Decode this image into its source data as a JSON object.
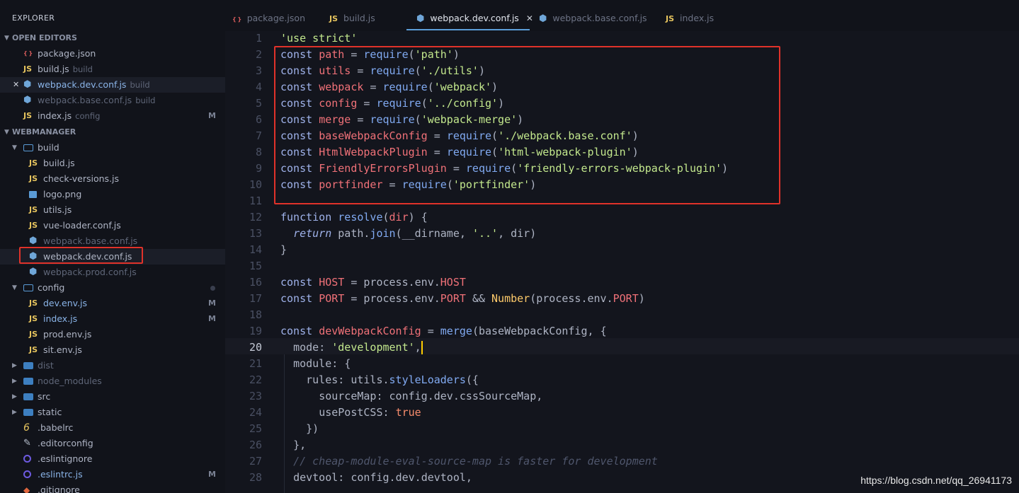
{
  "sidebar": {
    "title": "EXPLORER",
    "open_editors_header": "OPEN EDITORS",
    "open_editors": [
      {
        "icon": "json",
        "name": "package.json",
        "detail": "",
        "status": "",
        "prefix": ""
      },
      {
        "icon": "JS",
        "name": "build.js",
        "detail": "build",
        "status": "",
        "prefix": ""
      },
      {
        "icon": "hex",
        "name": "webpack.dev.conf.js",
        "detail": "build",
        "status": "",
        "prefix": "✕"
      },
      {
        "icon": "hex",
        "name": "webpack.base.conf.js",
        "detail": "build",
        "status": "",
        "prefix": ""
      },
      {
        "icon": "JS",
        "name": "index.js",
        "detail": "config",
        "status": "M",
        "prefix": ""
      }
    ],
    "project_header": "WEBMANAGER",
    "build_folder": "build",
    "build_files": [
      {
        "icon": "JS",
        "name": "build.js"
      },
      {
        "icon": "JS",
        "name": "check-versions.js"
      },
      {
        "icon": "img",
        "name": "logo.png"
      },
      {
        "icon": "JS",
        "name": "utils.js"
      },
      {
        "icon": "JS",
        "name": "vue-loader.conf.js"
      },
      {
        "icon": "hex",
        "name": "webpack.base.conf.js"
      },
      {
        "icon": "hex",
        "name": "webpack.dev.conf.js"
      },
      {
        "icon": "hex",
        "name": "webpack.prod.conf.js"
      }
    ],
    "config_folder": "config",
    "config_files": [
      {
        "icon": "JS",
        "name": "dev.env.js",
        "status": "M"
      },
      {
        "icon": "JS",
        "name": "index.js",
        "status": "M"
      },
      {
        "icon": "JS",
        "name": "prod.env.js",
        "status": ""
      },
      {
        "icon": "JS",
        "name": "sit.env.js",
        "status": ""
      }
    ],
    "collapsed_folders": [
      "dist",
      "node_modules",
      "src",
      "static"
    ],
    "root_files": [
      {
        "icon": "babel",
        "name": ".babelrc",
        "status": ""
      },
      {
        "icon": "gear",
        "name": ".editorconfig",
        "status": ""
      },
      {
        "icon": "ring",
        "name": ".eslintignore",
        "status": ""
      },
      {
        "icon": "ring",
        "name": ".eslintrc.js",
        "status": "M"
      },
      {
        "icon": "git",
        "name": ".gitignore",
        "status": ""
      }
    ]
  },
  "tabs": [
    {
      "icon": "json",
      "label": "package.json",
      "active": false
    },
    {
      "icon": "JS",
      "label": "build.js",
      "active": false
    },
    {
      "icon": "hex",
      "label": "webpack.dev.conf.js",
      "active": true
    },
    {
      "icon": "hex",
      "label": "webpack.base.conf.js",
      "active": false
    },
    {
      "icon": "JS",
      "label": "index.js",
      "active": false
    }
  ],
  "tab_close": "✕",
  "editor": {
    "current_line": 20,
    "lines": [
      [
        [
          "str",
          "'use strict'"
        ]
      ],
      [
        [
          "kw",
          "const "
        ],
        [
          "var",
          "path"
        ],
        [
          "",
          "  = "
        ],
        [
          "fn",
          "require"
        ],
        [
          "",
          "("
        ],
        [
          "str",
          "'path'"
        ],
        [
          "",
          ")"
        ]
      ],
      [
        [
          "kw",
          "const "
        ],
        [
          "var",
          "utils"
        ],
        [
          "",
          ""
        ],
        [
          "",
          ""
        ],
        [
          "",
          ""
        ],
        [
          "",
          ""
        ],
        [
          "",
          ""
        ]
      ],
      [],
      [],
      [],
      [],
      [],
      [],
      [],
      [],
      [],
      [],
      [],
      [],
      [],
      [],
      [],
      [],
      [],
      [],
      [],
      [],
      [],
      [],
      [],
      [],
      []
    ]
  },
  "code_lines": [
    "'use strict'",
    "const path = require('path')",
    "const utils = require('./utils')",
    "const webpack = require('webpack')",
    "const config = require('../config')",
    "const merge = require('webpack-merge')",
    "const baseWebpackConfig = require('./webpack.base.conf')",
    "const HtmlWebpackPlugin = require('html-webpack-plugin')",
    "const FriendlyErrorsPlugin = require('friendly-errors-webpack-plugin')",
    "const portfinder = require('portfinder')",
    "",
    "function resolve(dir) {",
    "  return path.join(__dirname, '..', dir)",
    "}",
    "",
    "const HOST = process.env.HOST",
    "const PORT = process.env.PORT && Number(process.env.PORT)",
    "",
    "const devWebpackConfig = merge(baseWebpackConfig, {",
    "  mode: 'development',",
    "  module: {",
    "    rules: utils.styleLoaders({",
    "      sourceMap: config.dev.cssSourceMap,",
    "      usePostCSS: true",
    "    })",
    "  },",
    "  // cheap-module-eval-source-map is faster for development",
    "  devtool: config.dev.devtool,"
  ],
  "watermark": "https://blog.csdn.net/qq_26941173"
}
